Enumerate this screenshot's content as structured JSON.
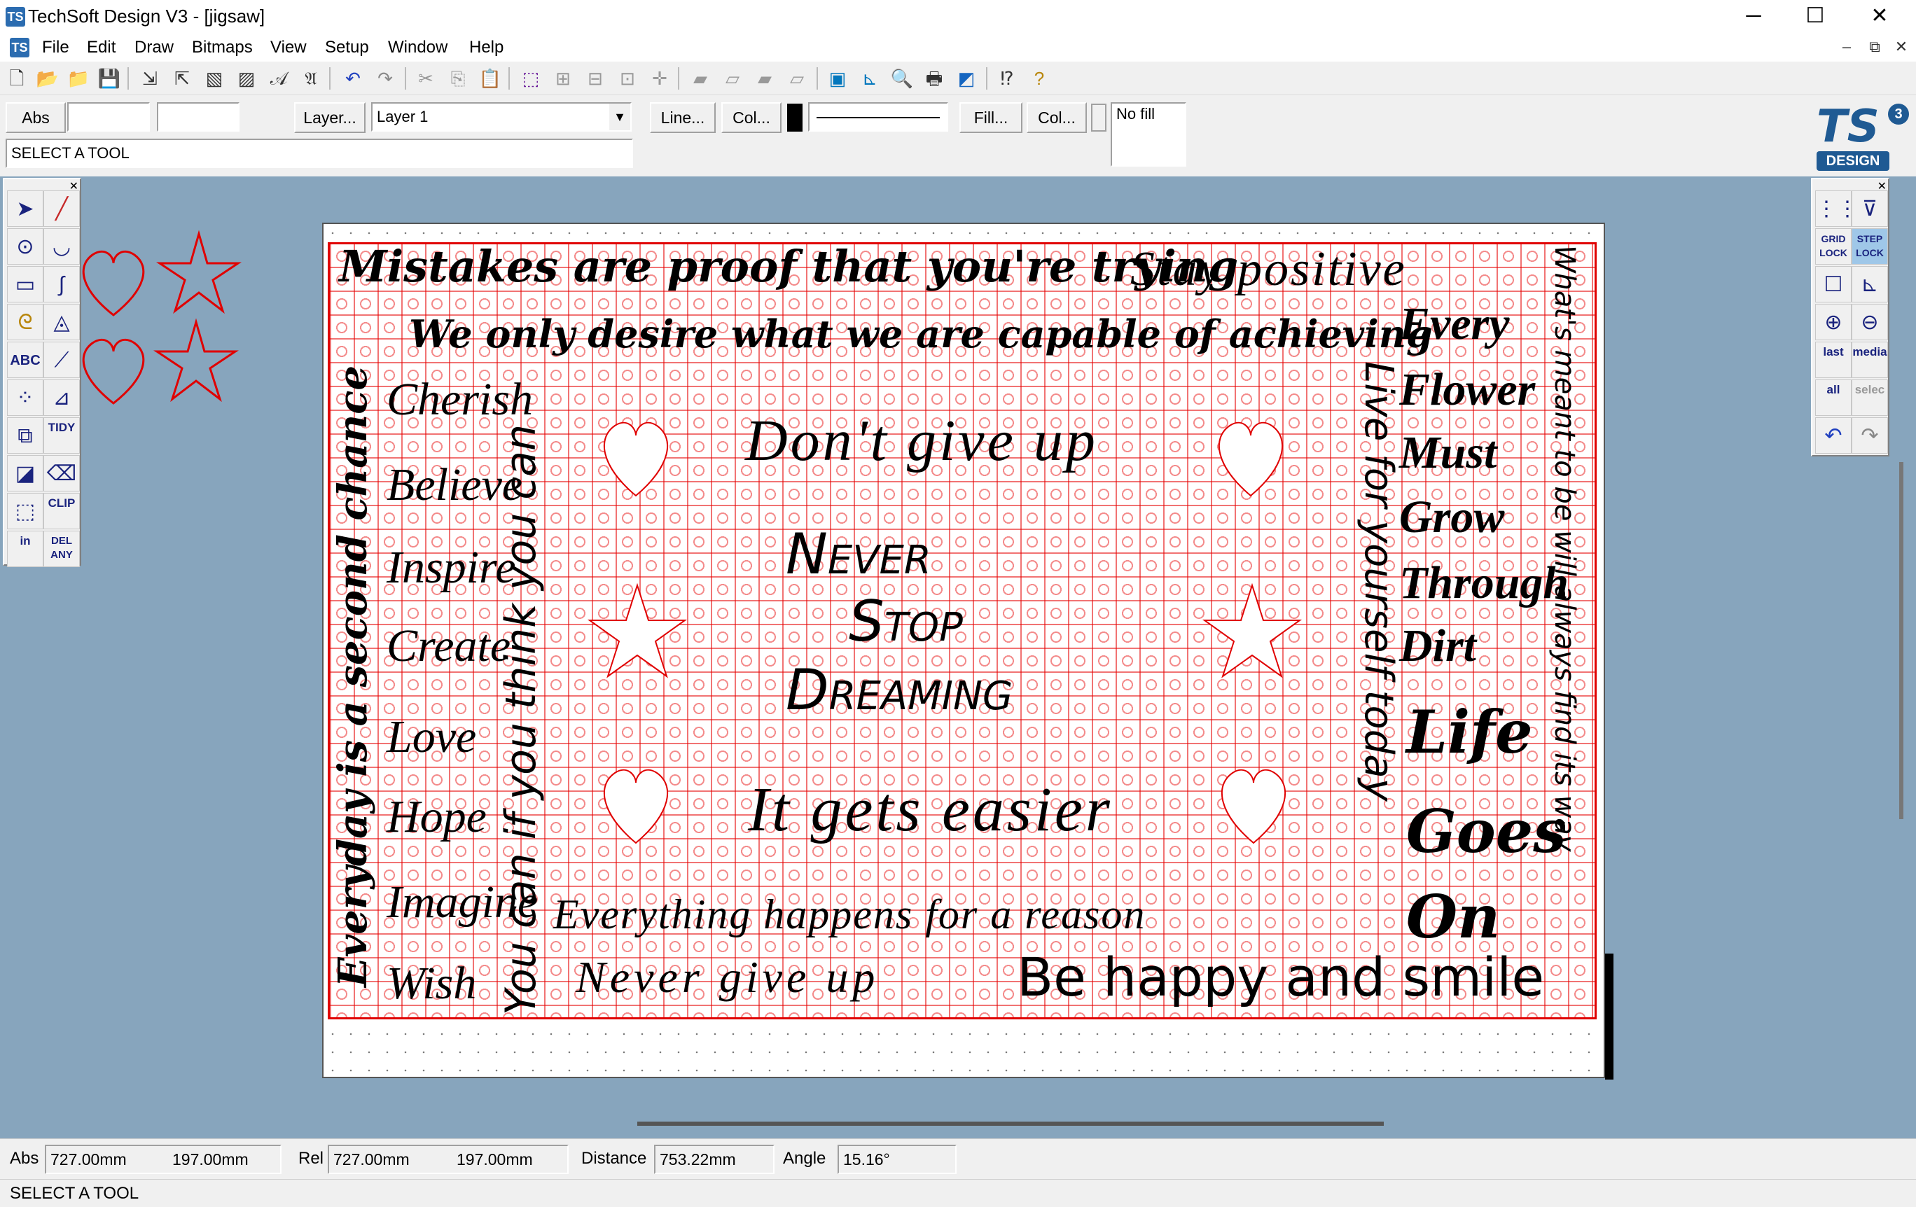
{
  "window": {
    "title": "TechSoft Design V3 - [jigsaw]",
    "app_icon": "TS",
    "controls": {
      "minimize": "─",
      "maximize": "☐",
      "close": "✕"
    }
  },
  "menubar": {
    "items": [
      "File",
      "Edit",
      "Draw",
      "Bitmaps",
      "View",
      "Setup",
      "Window",
      "Help"
    ],
    "mdi_controls": {
      "minimize": "–",
      "restore": "⧉",
      "close": "✕"
    }
  },
  "toolbar": {
    "icons": [
      "new-icon",
      "open-icon",
      "open-folder-icon",
      "save-icon",
      "import-icon",
      "export-icon",
      "bitmap-import-icon",
      "bitmap-export-icon",
      "font-icon",
      "text-style-icon",
      "undo-icon",
      "redo-icon",
      "cut-icon",
      "copy-icon",
      "paste-icon",
      "select-icon",
      "group-icon",
      "ungroup-icon",
      "align-icon",
      "centre-icon",
      "layer-front-icon",
      "layer-back-icon",
      "layer-up-icon",
      "layer-down-icon",
      "plot-icon",
      "measure-icon",
      "zoom-icon",
      "print-icon",
      "cutter-icon",
      "whats-this-icon",
      "help-icon"
    ]
  },
  "props": {
    "abs_button": "Abs",
    "x_value": "",
    "y_value": "",
    "layer_button": "Layer...",
    "layer_select": "Layer 1",
    "line_button": "Line...",
    "line_colour_button": "Col...",
    "fill_button": "Fill...",
    "fill_colour_button": "Col...",
    "fill_text": "No fill",
    "status_prompt": "SELECT A TOOL",
    "logo_text": "TS",
    "logo_sub": "DESIGN",
    "logo_badge": "3"
  },
  "left_tools": {
    "text_tool": "ABC",
    "tidy_label": "TIDY",
    "clip_label": "CLIP",
    "in_label": "in",
    "del_label": "DEL ANY"
  },
  "right_tools": {
    "grid_lock": "GRID LOCK",
    "step_lock": "STEP LOCK",
    "last": "last",
    "media": "media",
    "all": "all",
    "select": "selec"
  },
  "canvas": {
    "line_colour": "#e00000",
    "texts": {
      "mistakes": "Mistakes are proof that you're trying",
      "stay_positive": "Stay positive",
      "desire": "We only desire what we are capable of achieving",
      "cherish": "Cherish",
      "believe": "Believe",
      "inspire": "Inspire",
      "create": "Create",
      "love": "Love",
      "hope": "Hope",
      "imagine": "Imagine",
      "wish": "Wish",
      "everyday": "Everyday is a second chance",
      "you_can": "You can if you think you can",
      "dont_give_up": "Don't give up",
      "never": "Never",
      "stop": "Stop",
      "dreaming": "Dreaming",
      "gets_easier": "It gets easier",
      "everything_happens": "Everything happens for a reason",
      "never_give_up": "Never give up",
      "be_happy": "Be happy and smile",
      "live_for": "Live for yourself today",
      "whats_meant": "What's meant to be will always find its way",
      "every": "Every",
      "flower": "Flower",
      "must": "Must",
      "grow": "Grow",
      "through": "Through",
      "dirt": "Dirt",
      "life": "Life",
      "goes": "Goes",
      "on": "On"
    }
  },
  "coords": {
    "abs_label": "Abs",
    "abs_x": "727.00mm",
    "abs_y": "197.00mm",
    "rel_label": "Rel",
    "rel_x": "727.00mm",
    "rel_y": "197.00mm",
    "distance_label": "Distance",
    "distance": "753.22mm",
    "angle_label": "Angle",
    "angle": "15.16°"
  },
  "statusbar": {
    "text": "SELECT A TOOL"
  }
}
